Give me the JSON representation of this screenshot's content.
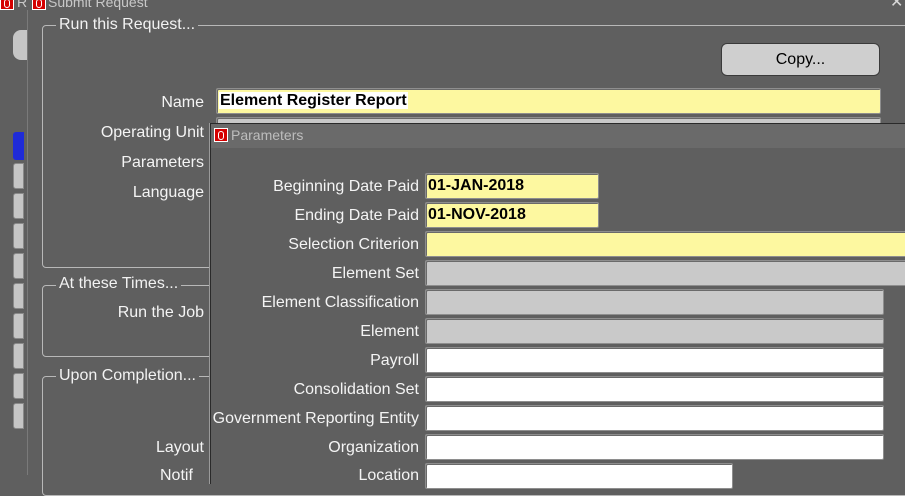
{
  "window": {
    "title": "Submit Request",
    "title_prefix": "R"
  },
  "request_group": {
    "legend": "Run this Request...",
    "copy_label": "Copy...",
    "name_label": "Name",
    "name_value": "Element Register Report",
    "operating_unit_label": "Operating Unit",
    "parameters_label": "Parameters",
    "language_label": "Language"
  },
  "times_group": {
    "legend": "At these Times...",
    "run_job_label": "Run the Job"
  },
  "completion_group": {
    "legend": "Upon Completion...",
    "layout_label": "Layout",
    "notify_label": "Notif"
  },
  "parameters_dialog": {
    "title": "Parameters",
    "fields": [
      {
        "label": "Beginning Date Paid",
        "value": "01-JAN-2018"
      },
      {
        "label": "Ending Date Paid",
        "value": "01-NOV-2018"
      },
      {
        "label": "Selection Criterion",
        "value": ""
      },
      {
        "label": "Element Set",
        "value": ""
      },
      {
        "label": "Element Classification",
        "value": ""
      },
      {
        "label": "Element",
        "value": ""
      },
      {
        "label": "Payroll",
        "value": ""
      },
      {
        "label": "Consolidation Set",
        "value": ""
      },
      {
        "label": "Government Reporting Entity",
        "value": ""
      },
      {
        "label": "Organization",
        "value": ""
      },
      {
        "label": "Location",
        "value": ""
      }
    ]
  },
  "colors": {
    "background": "#5f5f5f",
    "required_field": "#fdf8a0",
    "disabled_field": "#c9c9c9",
    "active_tab": "#1f2bd8",
    "oracle_icon": "#d40000"
  }
}
